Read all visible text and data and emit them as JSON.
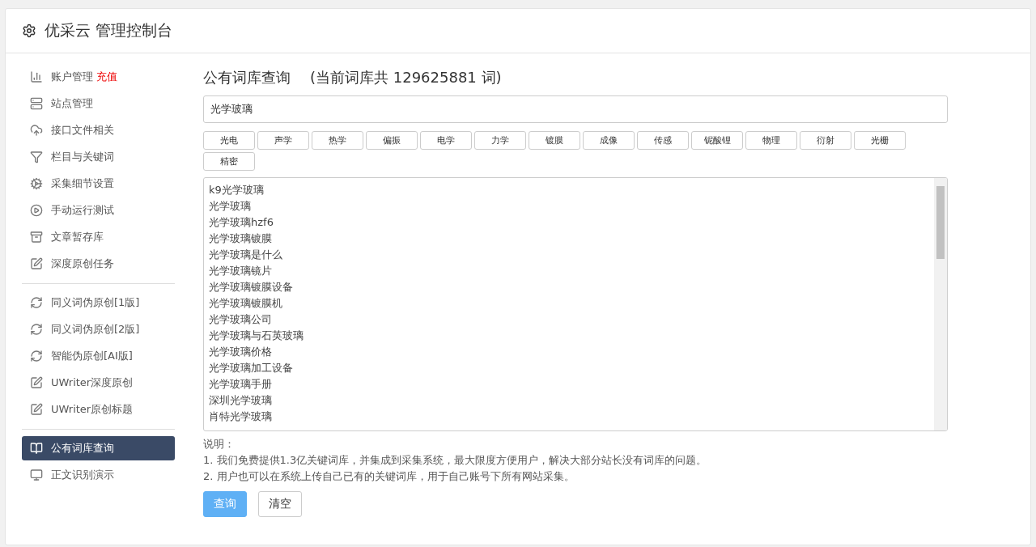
{
  "header": {
    "title": "优采云 管理控制台"
  },
  "sidebar": {
    "groups": [
      {
        "items": [
          {
            "kind": "chart",
            "label": "账户管理",
            "extra": "充值",
            "selected": false
          },
          {
            "kind": "server",
            "label": "站点管理",
            "selected": false
          },
          {
            "kind": "cloud",
            "label": "接口文件相关",
            "selected": false
          },
          {
            "kind": "filter",
            "label": "栏目与关键词",
            "selected": false
          },
          {
            "kind": "cogs",
            "label": "采集细节设置",
            "selected": false
          },
          {
            "kind": "play",
            "label": "手动运行测试",
            "selected": false
          },
          {
            "kind": "archive",
            "label": "文章暂存库",
            "selected": false
          },
          {
            "kind": "edit",
            "label": "深度原创任务",
            "selected": false
          }
        ]
      },
      {
        "items": [
          {
            "kind": "refresh",
            "label": "同义词伪原创[1版]",
            "selected": false
          },
          {
            "kind": "refresh",
            "label": "同义词伪原创[2版]",
            "selected": false
          },
          {
            "kind": "refresh",
            "label": "智能伪原创[AI版]",
            "selected": false
          },
          {
            "kind": "edit",
            "label": "UWriter深度原创",
            "selected": false
          },
          {
            "kind": "edit",
            "label": "UWriter原创标题",
            "selected": false
          }
        ]
      },
      {
        "items": [
          {
            "kind": "book",
            "label": "公有词库查询",
            "selected": true
          },
          {
            "kind": "monitor",
            "label": "正文识别演示",
            "selected": false
          }
        ]
      }
    ]
  },
  "main": {
    "title": "公有词库查询",
    "subtitle": "(当前词库共 129625881 词)",
    "search": {
      "value": "光学玻璃"
    },
    "tags": [
      "光电",
      "声学",
      "热学",
      "偏振",
      "电学",
      "力学",
      "镀膜",
      "成像",
      "传感",
      "铌酸锂",
      "物理",
      "衍射",
      "光栅",
      "精密"
    ],
    "results": [
      "k9光学玻璃",
      "光学玻璃",
      "光学玻璃hzf6",
      "光学玻璃镀膜",
      "光学玻璃是什么",
      "光学玻璃镜片",
      "光学玻璃镀膜设备",
      "光学玻璃镀膜机",
      "光学玻璃公司",
      "光学玻璃与石英玻璃",
      "光学玻璃价格",
      "光学玻璃加工设备",
      "光学玻璃手册",
      "深圳光学玻璃",
      "肖特光学玻璃"
    ],
    "notes_title": "说明：",
    "notes": [
      "1. 我们免费提供1.3亿关键词库，并集成到采集系统，最大限度方便用户，解决大部分站长没有词库的问题。",
      "2. 用户也可以在系统上传自己已有的关键词库，用于自己账号下所有网站采集。"
    ],
    "buttons": [
      {
        "kind": "primary",
        "label": "查询"
      },
      {
        "kind": "default",
        "label": "清空"
      }
    ]
  }
}
